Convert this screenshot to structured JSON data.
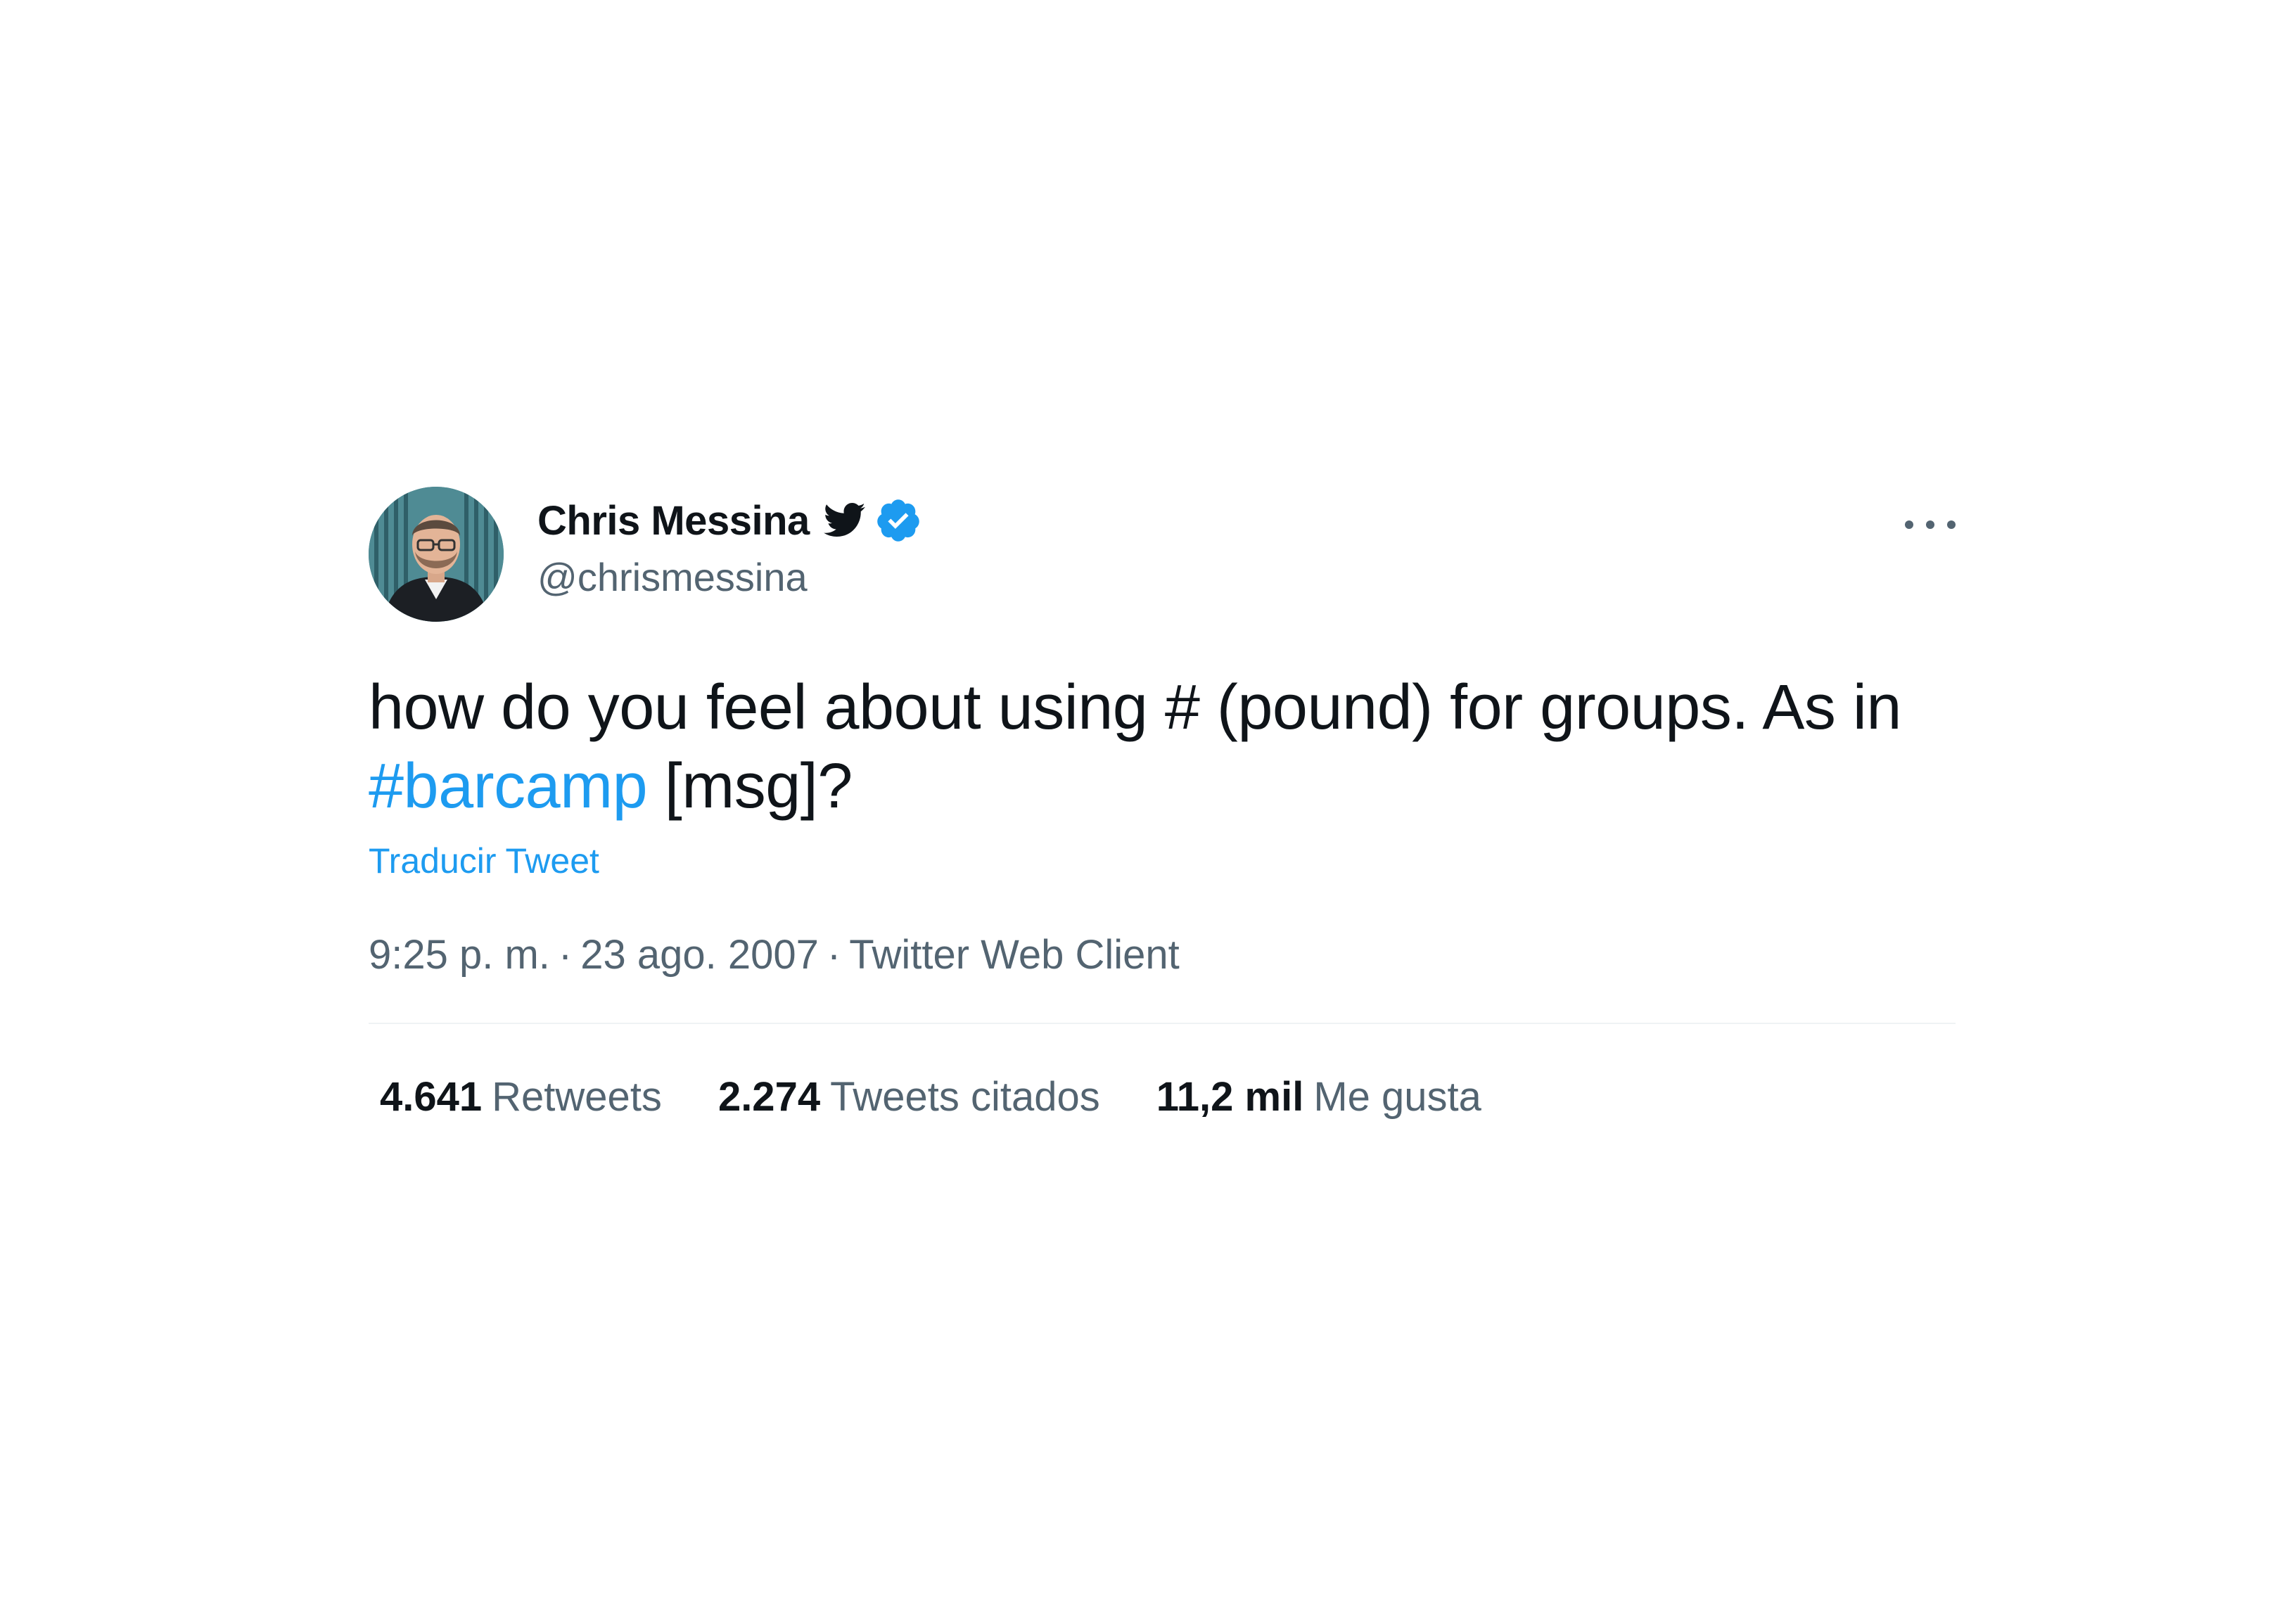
{
  "tweet": {
    "author": {
      "display_name": "Chris Messina",
      "handle": "@chrismessina",
      "verified": true
    },
    "text_before": "how do you feel about using # (pound) for groups. As in ",
    "hashtag": "#barcamp",
    "text_after": " [msg]?",
    "translate_label": "Traducir Tweet",
    "time": "9:25 p. m.",
    "date": "23 ago. 2007",
    "source": "Twitter Web Client",
    "separator": "·",
    "stats": {
      "retweets": {
        "count": "4.641",
        "label": "Retweets"
      },
      "quotes": {
        "count": "2.274",
        "label": "Tweets citados"
      },
      "likes": {
        "count": "11,2 mil",
        "label": "Me gusta"
      }
    }
  },
  "icons": {
    "more": "more-horizontal-icon",
    "bird": "twitter-bird-icon",
    "verified": "verified-badge-icon"
  },
  "colors": {
    "text_primary": "#0f1419",
    "text_secondary": "#536471",
    "accent": "#1d9bf0",
    "divider": "#eff3f4"
  }
}
